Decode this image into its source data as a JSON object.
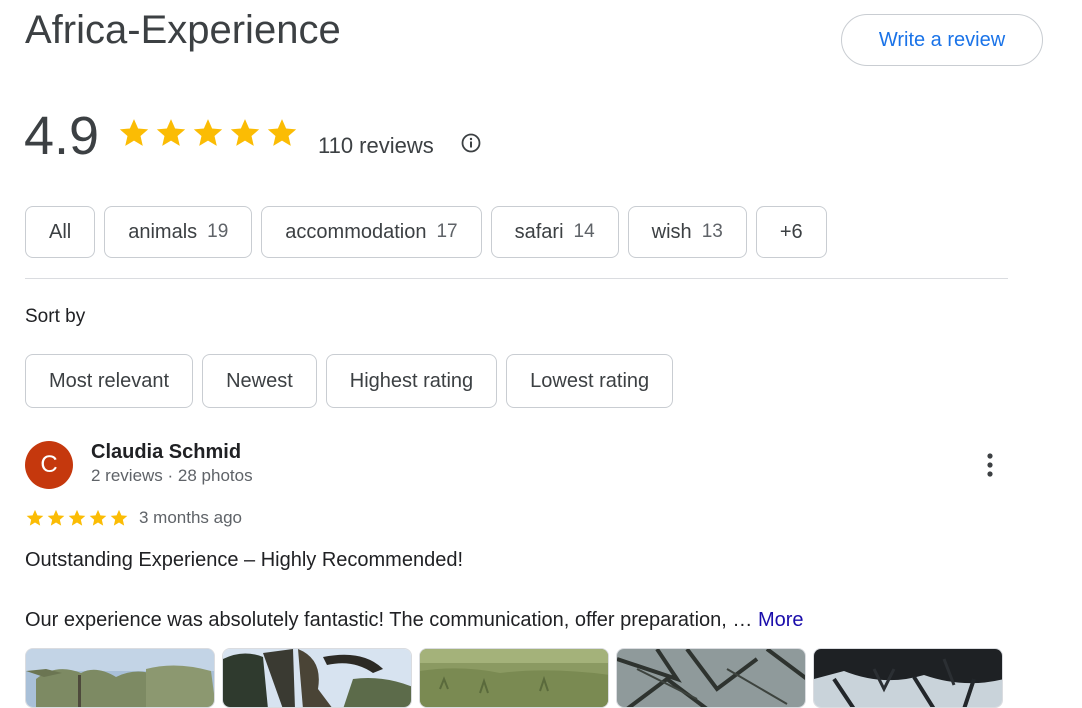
{
  "place": {
    "title": "Africa-Experience",
    "write_review_label": "Write a review"
  },
  "summary": {
    "rating": "4.9",
    "stars": 5,
    "reviews_count": "110 reviews",
    "star_color": "#fbbc04"
  },
  "topics": [
    {
      "label": "All",
      "count": ""
    },
    {
      "label": "animals",
      "count": "19"
    },
    {
      "label": "accommodation",
      "count": "17"
    },
    {
      "label": "safari",
      "count": "14"
    },
    {
      "label": "wish",
      "count": "13"
    },
    {
      "label": "+6",
      "count": ""
    }
  ],
  "sort": {
    "label": "Sort by",
    "options": [
      "Most relevant",
      "Newest",
      "Highest rating",
      "Lowest rating"
    ]
  },
  "review": {
    "avatar_initial": "C",
    "avatar_color": "#c5380d",
    "name": "Claudia Schmid",
    "meta": "2 reviews · 28 photos",
    "stars": 5,
    "date": "3 months ago",
    "headline": "Outstanding Experience – Highly Recommended!",
    "body": "Our experience was absolutely fantastic! The communication, offer preparation, … ",
    "more_label": "More",
    "photos": [
      "photo-acacia-sky",
      "photo-tree-branches",
      "photo-grassland",
      "photo-thorn-tree",
      "photo-dark-canopy"
    ]
  },
  "colors": {
    "accent_link": "#1a73e8",
    "more_link": "#1a0dab",
    "border": "#c9cdd2"
  }
}
